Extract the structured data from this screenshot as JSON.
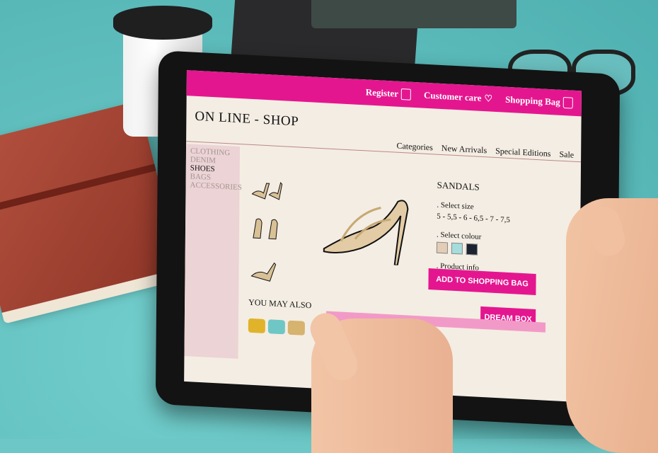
{
  "header": {
    "register": "Register",
    "customer_care": "Customer care",
    "shopping_bag": "Shopping Bag"
  },
  "shop_title": "ON LINE - SHOP",
  "nav": [
    "Categories",
    "New Arrivals",
    "Special Editions",
    "Sale"
  ],
  "sidebar": [
    "CLOTHING",
    "DENIM",
    "SHOES",
    "BAGS",
    "ACCESSORIES"
  ],
  "product": {
    "name": "SANDALS",
    "select_size": ". Select size",
    "sizes": "5 - 5,5 - 6 - 6,5 - 7 - 7,5",
    "select_colour": ". Select colour",
    "product_info": ". Product info"
  },
  "swatch_colors": [
    "#e3cdb5",
    "#a6dcdc",
    "#1b2230"
  ],
  "buttons": {
    "add_to_bag": "ADD TO SHOPPING BAG",
    "dream_box": "DREAM BOX"
  },
  "you_may_also": "YOU MAY ALSO",
  "colors": {
    "accent": "#e4168f",
    "sidebar": "#ecd3d5",
    "screen": "#f4ede3"
  }
}
